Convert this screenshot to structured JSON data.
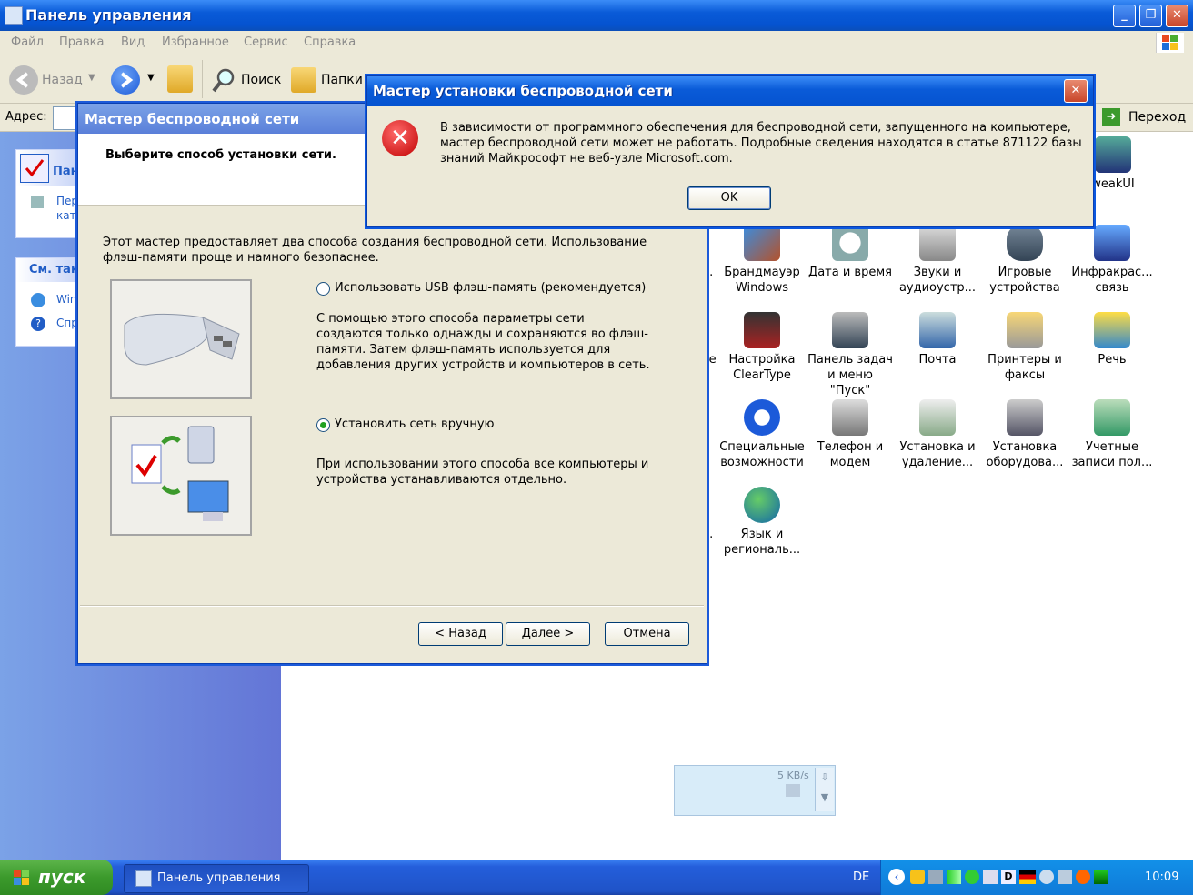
{
  "window": {
    "title": "Панель управления"
  },
  "menu": [
    "Файл",
    "Правка",
    "Вид",
    "Избранное",
    "Сервис",
    "Справка"
  ],
  "toolbar": {
    "back": "Назад",
    "search": "Поиск",
    "folders": "Папки"
  },
  "address": {
    "label": "Адрес:",
    "go": "Переход"
  },
  "left_pane": {
    "panel1_title": "Пан",
    "panel1_item": "Пер кат",
    "panel2_title": "См. так",
    "panel2_items": [
      "Win",
      "Спр"
    ]
  },
  "icons": [
    {
      "label": "weakUI",
      "icon": "tweakui-icon"
    },
    {
      "label": "Брандмауэр Windows",
      "icon": "firewall-icon"
    },
    {
      "label": "Дата и время",
      "icon": "clock-icon"
    },
    {
      "label": "Звуки и аудиоустр...",
      "icon": "sound-icon"
    },
    {
      "label": "Игровые устройства",
      "icon": "gamepad-icon"
    },
    {
      "label": "Инфракрас... связь",
      "icon": "infrared-icon"
    },
    {
      "label": "Настройка ClearType",
      "icon": "cleartype-icon"
    },
    {
      "label": "Панель задач и меню \"Пуск\"",
      "icon": "taskbar-icon"
    },
    {
      "label": "Почта",
      "icon": "mail-icon"
    },
    {
      "label": "Принтеры и факсы",
      "icon": "printer-icon"
    },
    {
      "label": "Речь",
      "icon": "speech-icon"
    },
    {
      "label": "Специальные возможности",
      "icon": "accessibility-icon"
    },
    {
      "label": "Телефон и модем",
      "icon": "phone-icon"
    },
    {
      "label": "Установка и удаление...",
      "icon": "addremove-icon"
    },
    {
      "label": "Установка оборудова...",
      "icon": "hardware-icon"
    },
    {
      "label": "Учетные записи пол...",
      "icon": "users-icon"
    },
    {
      "label": "Язык и региональ...",
      "icon": "globe-icon"
    }
  ],
  "wizard": {
    "title": "Мастер беспроводной сети",
    "heading": "Выберите способ установки сети.",
    "intro": "Этот мастер предоставляет два способа создания беспроводной сети. Использование флэш-памяти проще и намного безопаснее.",
    "option1": {
      "label": "Использовать USB флэш-память (рекомендуется)",
      "desc": "С помощью этого способа параметры сети создаются только однажды и сохраняются во флэш-памяти. Затем флэш-память используется для добавления других устройств и компьютеров в сеть.",
      "selected": false
    },
    "option2": {
      "label": "Установить сеть вручную",
      "desc": "При использовании этого способа все компьютеры и устройства устанавливаются отдельно.",
      "selected": true
    },
    "buttons": {
      "back": "< Назад",
      "next": "Далее >",
      "cancel": "Отмена"
    }
  },
  "error_dialog": {
    "title": "Мастер установки беспроводной сети",
    "message": "В зависимости от программного обеспечения для беспроводной сети, запущенного на компьютере, мастер беспроводной сети может не работать. Подробные сведения находятся в статье 871122 базы знаний Майкрософт не веб-узле Microsoft.com.",
    "ok": "OK"
  },
  "net_widget": {
    "speed": "5 KB/s"
  },
  "taskbar": {
    "start": "пуск",
    "task": "Панель управления",
    "lang": "DE",
    "clock": "10:09"
  },
  "colors": {
    "xp_blue": "#0553d0",
    "start_green": "#3c9a2c",
    "error_red": "#c00000"
  }
}
